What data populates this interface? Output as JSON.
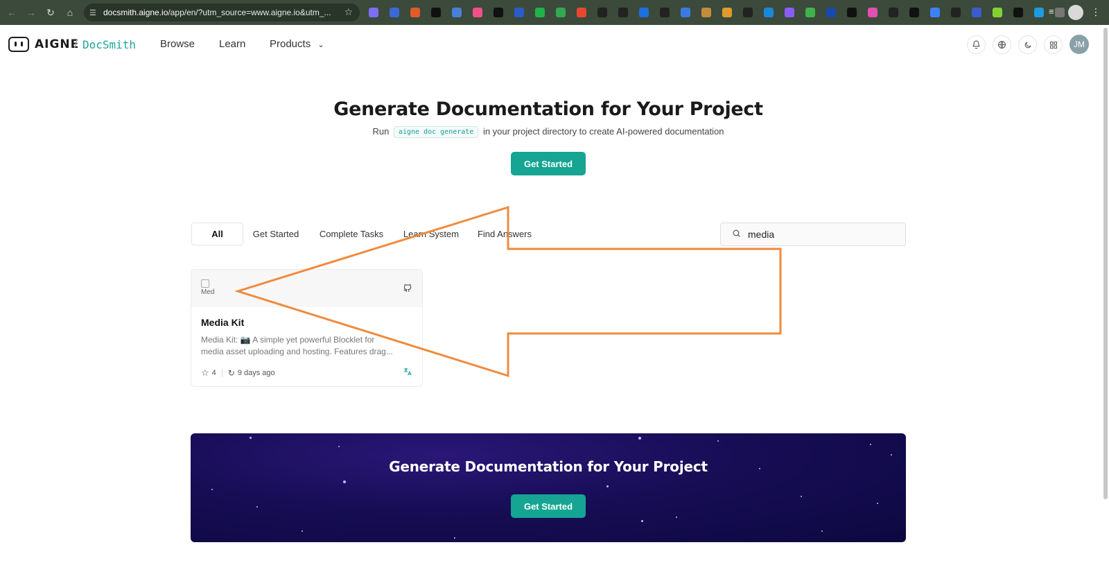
{
  "browser": {
    "url_host": "docsmith.aigne.io",
    "url_rest": "/app/en/?utm_source=www.aigne.io&utm_...",
    "extension_colors": [
      "#7c6ef2",
      "#3a6ad8",
      "#e05a2b",
      "#111111",
      "#4a7fd6",
      "#f0508a",
      "#111111",
      "#2b5ac9",
      "#21b24b",
      "#32a852",
      "#e8472f",
      "#222222",
      "#222222",
      "#1d6fe0",
      "#222222",
      "#3a7ae0",
      "#c38b3c",
      "#e09a2b",
      "#222222",
      "#1b87d9",
      "#8a5cf6",
      "#3fb34b",
      "#1849b0",
      "#111111",
      "#e04fb2",
      "#222222",
      "#111111",
      "#3b82f6",
      "#222222",
      "#3b5ccc",
      "#82d332",
      "#111111",
      "#1d9ae0",
      "#777777"
    ]
  },
  "header": {
    "logo_text": "AIGNE",
    "logo_slash": "/",
    "product_name": "DocSmith",
    "nav": [
      "Browse",
      "Learn",
      "Products"
    ],
    "avatar_initials": "JM"
  },
  "hero": {
    "title": "Generate Documentation for Your Project",
    "sub_before": "Run",
    "command": "aigne doc generate",
    "sub_after": "in your project directory to create AI-powered documentation",
    "cta": "Get Started"
  },
  "filters": {
    "tabs": [
      "All",
      "Get Started",
      "Complete Tasks",
      "Learn System",
      "Find Answers"
    ],
    "active_tab": "All",
    "search_value": "media"
  },
  "card": {
    "image_alt": "Med",
    "title": "Media Kit",
    "desc_line1": "Media Kit: 📷 A simple yet powerful Blocklet for",
    "desc_line2": "media asset uploading and hosting. Features drag...",
    "stars": "4",
    "updated": "9 days ago"
  },
  "banner": {
    "title": "Generate Documentation for Your Project",
    "cta": "Get Started"
  },
  "colors": {
    "accent": "#15a592",
    "annotation_arrow": "#f08a3c",
    "banner_bg": "#170d55"
  }
}
